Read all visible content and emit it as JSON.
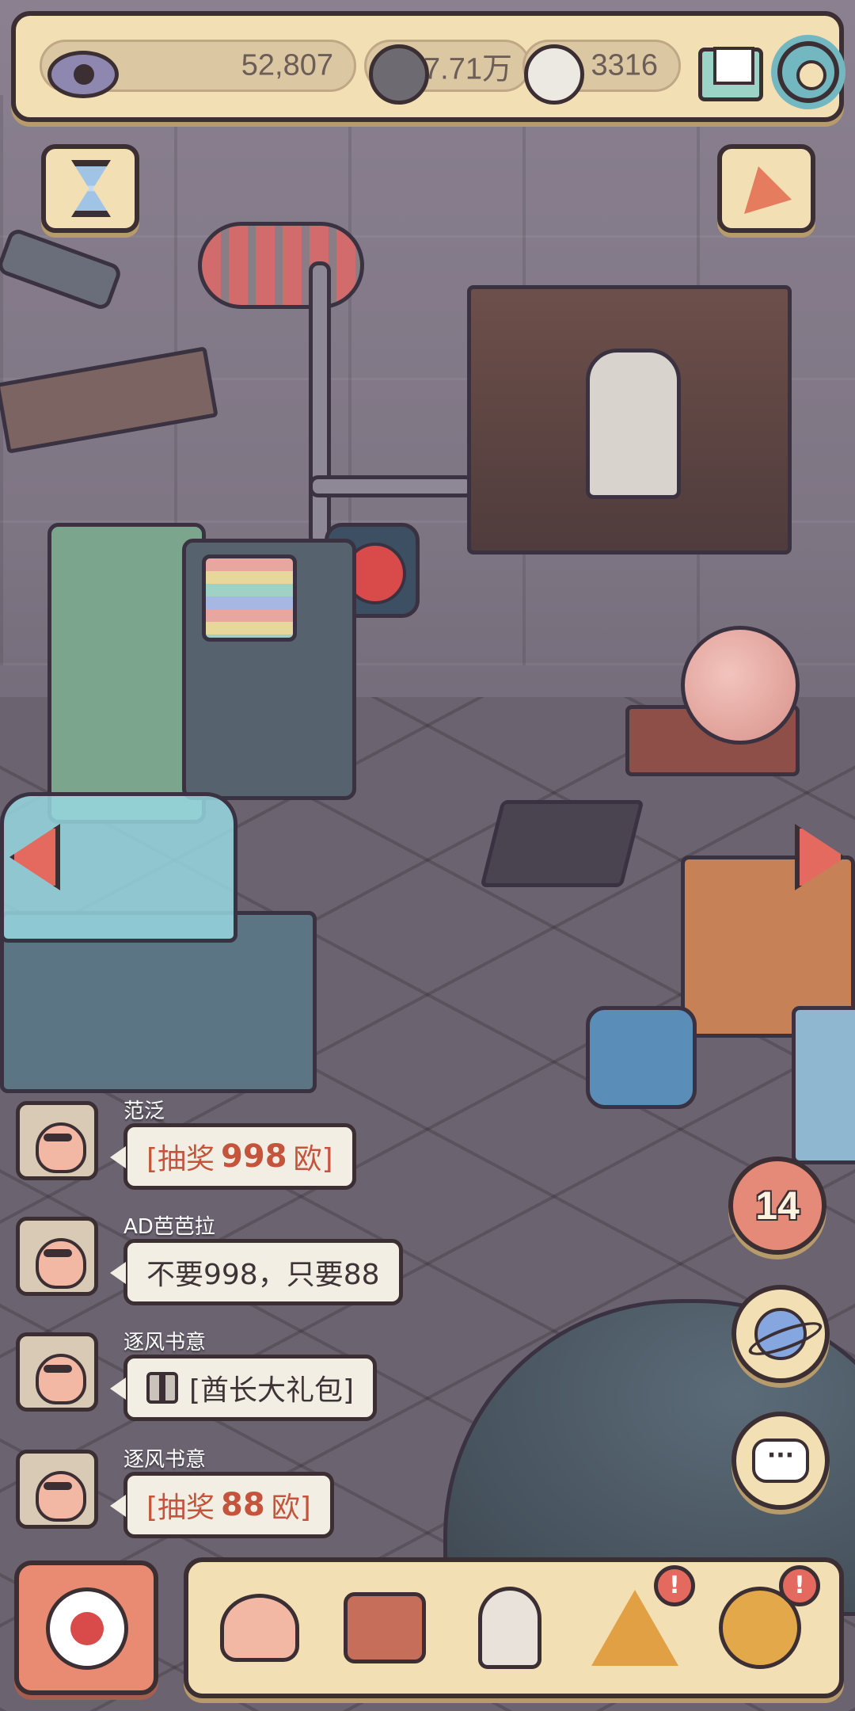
{
  "hud": {
    "views": "52,807",
    "coins_dark": "7.71万",
    "coins_light": "3316"
  },
  "chat": {
    "messages": [
      {
        "user": "范泛",
        "prefix": "[抽奖",
        "number": "998",
        "suffix": "欧]"
      },
      {
        "user": "AD芭芭拉",
        "text": "不要998，只要88"
      },
      {
        "user": "逐风书意",
        "text": "[酋长大礼包]",
        "icon": "gift-icon"
      },
      {
        "user": "逐风书意",
        "prefix": "[抽奖",
        "number": "88",
        "suffix": "欧]"
      }
    ]
  },
  "side": {
    "badge_count": "14"
  },
  "dock": {
    "alert_mark": "!"
  },
  "icons": {
    "top_left": "eye-icon",
    "currency_dark": "dark-speech-bubble-icon",
    "currency_light": "light-speech-bubble-icon",
    "mail": "mail-icon",
    "settings": "gear-icon",
    "hourglass": "hourglass-icon",
    "party": "party-popper-icon",
    "planet": "planet-icon",
    "chat": "chat-bubble-icon",
    "record": "record-icon",
    "snail": "snail-icon",
    "suitcase": "suitcase-icon",
    "bust": "statue-bust-icon",
    "pyramid": "eye-pyramid-icon",
    "key": "key-icon"
  },
  "colors": {
    "panel": "#f3dfb4",
    "outline": "#3b2f33",
    "accent_red": "#e46a60",
    "link_text": "#c5543d"
  }
}
